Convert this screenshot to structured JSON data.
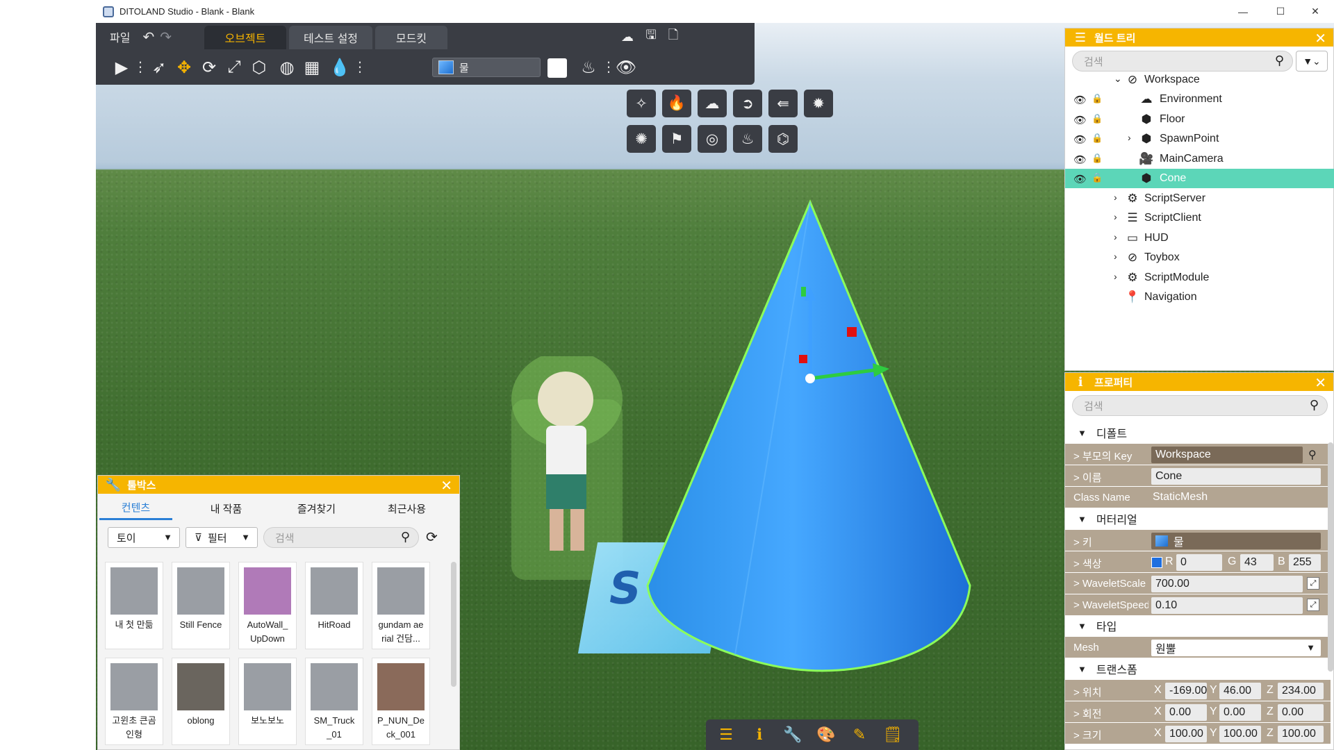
{
  "window": {
    "title": "DITOLAND Studio - Blank - Blank",
    "minimize": "—",
    "maximize": "☐",
    "close": "✕"
  },
  "toolbar": {
    "file_menu": "파일",
    "tabs": [
      {
        "label": "오브젝트",
        "active": true
      },
      {
        "label": "테스트 설정",
        "active": false
      },
      {
        "label": "모드킷",
        "active": false
      }
    ],
    "material_name": "물",
    "color_swatch": "#ffffff"
  },
  "world_tree": {
    "title": "월드 트리",
    "search_placeholder": "검색",
    "items": [
      {
        "label": "Workspace",
        "icon": "workspace-icon",
        "expanded": true
      },
      {
        "label": "Environment",
        "icon": "environment-icon"
      },
      {
        "label": "Floor",
        "icon": "cube-icon"
      },
      {
        "label": "SpawnPoint",
        "icon": "cube-icon"
      },
      {
        "label": "MainCamera",
        "icon": "camera-icon"
      },
      {
        "label": "Cone",
        "icon": "cube-icon",
        "selected": true
      },
      {
        "label": "ScriptServer",
        "icon": "script-server-icon"
      },
      {
        "label": "ScriptClient",
        "icon": "script-client-icon"
      },
      {
        "label": "HUD",
        "icon": "hud-icon"
      },
      {
        "label": "Toybox",
        "icon": "toybox-icon"
      },
      {
        "label": "ScriptModule",
        "icon": "script-module-icon"
      },
      {
        "label": "Navigation",
        "icon": "location-pin-icon"
      }
    ]
  },
  "properties": {
    "title": "프로퍼티",
    "search_placeholder": "검색",
    "sections": {
      "default": "디폴트",
      "material": "머터리얼",
      "type": "타입",
      "transform": "트랜스폼"
    },
    "parent_key_label": "> 부모의 Key",
    "parent_key_value": "Workspace",
    "name_label": "> 이름",
    "name_value": "Cone",
    "class_name_label": "Class Name",
    "class_name_value": "StaticMesh",
    "key_label": "> 키",
    "key_value": "물",
    "color_label": "> 색상",
    "color_r": "0",
    "color_g": "43",
    "color_b": "255",
    "color_swatch": "#1e6fe0",
    "wavelet_scale_label": "> WaveletScale",
    "wavelet_scale_value": "700.00",
    "wavelet_speed_label": "> WaveletSpeed",
    "wavelet_speed_value": "0.10",
    "mesh_label": "Mesh",
    "mesh_value": "원뿔",
    "position_label": "> 위치",
    "position": {
      "x": "-169.00",
      "y": "46.00",
      "z": "234.00"
    },
    "rotation_label": "> 회전",
    "rotation": {
      "x": "0.00",
      "y": "0.00",
      "z": "0.00"
    },
    "scale_label": "> 크기",
    "scale": {
      "x": "100.00",
      "y": "100.00",
      "z": "100.00"
    }
  },
  "toolbox": {
    "title": "툴박스",
    "tabs": [
      "컨텐츠",
      "내 작품",
      "즐겨찾기",
      "최근사용"
    ],
    "category": "토이",
    "filter": "필터",
    "search_placeholder": "검색",
    "items": [
      "내 첫 만듦",
      "Still Fence",
      "AutoWall_\nUpDown",
      "HitRoad",
      "gundam ae\nrial 건담...",
      "고윈초 큰곰\n인형",
      "oblong",
      "보노보노",
      "SM_Truck\n_01",
      "P_NUN_De\nck_001"
    ]
  },
  "scene": {
    "spawn_letter": "S"
  }
}
